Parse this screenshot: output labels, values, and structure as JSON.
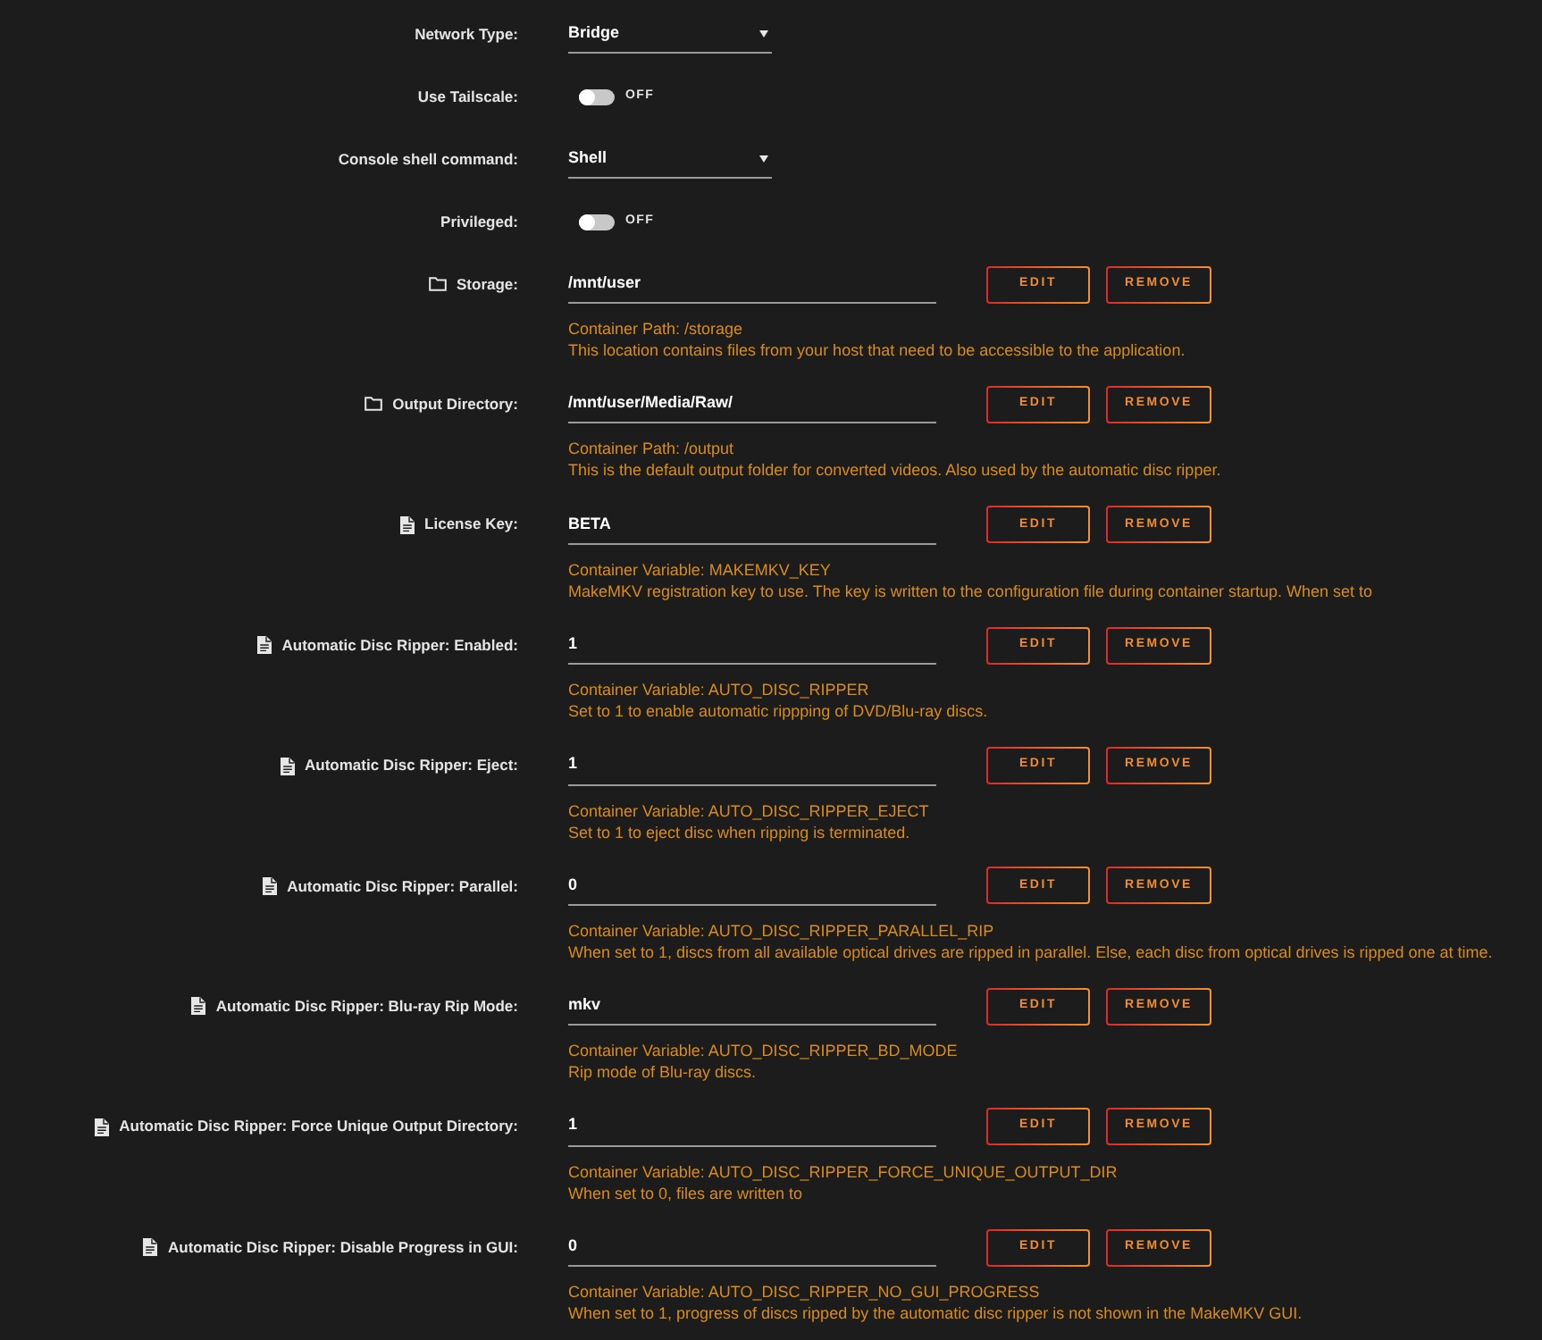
{
  "settings": [
    {
      "kind": "select",
      "label": "Network Type:",
      "value": "Bridge"
    },
    {
      "kind": "toggle",
      "label": "Use Tailscale:",
      "on": false,
      "state_text": "OFF"
    },
    {
      "kind": "select",
      "label": "Console shell command:",
      "value": "Shell"
    },
    {
      "kind": "toggle",
      "label": "Privileged:",
      "on": false,
      "state_text": "OFF"
    }
  ],
  "config": [
    {
      "kind": "path",
      "label": "Storage:",
      "value": "/mnt/user",
      "container": "Container Path: /storage",
      "description": "This location contains files from your host that need to be accessible to the application.",
      "actions": [
        "EDIT",
        "REMOVE"
      ]
    },
    {
      "kind": "path",
      "label": "Output Directory:",
      "value": "/mnt/user/Media/Raw/",
      "container": "Container Path: /output",
      "description": "This is the default output folder for converted videos. Also used by the automatic disc ripper.",
      "actions": [
        "EDIT",
        "REMOVE"
      ]
    },
    {
      "kind": "variable",
      "label": "License Key:",
      "value": "BETA",
      "container": "Container Variable: MAKEMKV_KEY",
      "description": "MakeMKV registration key to use. The key is written to the configuration file during container startup. When set to",
      "actions": [
        "EDIT",
        "REMOVE"
      ]
    },
    {
      "kind": "variable",
      "label": "Automatic Disc Ripper: Enabled:",
      "value": "1",
      "container": "Container Variable: AUTO_DISC_RIPPER",
      "description": "Set to 1 to enable automatic rippping of DVD/Blu-ray discs.",
      "actions": [
        "EDIT",
        "REMOVE"
      ]
    },
    {
      "kind": "variable",
      "label": "Automatic Disc Ripper: Eject:",
      "value": "1",
      "container": "Container Variable: AUTO_DISC_RIPPER_EJECT",
      "description": "Set to 1 to eject disc when ripping is terminated.",
      "actions": [
        "EDIT",
        "REMOVE"
      ]
    },
    {
      "kind": "variable",
      "label": "Automatic Disc Ripper: Parallel:",
      "value": "0",
      "container": "Container Variable: AUTO_DISC_RIPPER_PARALLEL_RIP",
      "description": "When set to 1, discs from all available optical drives are ripped in parallel. Else, each disc from optical drives is ripped one at time.",
      "actions": [
        "EDIT",
        "REMOVE"
      ]
    },
    {
      "kind": "variable",
      "label": "Automatic Disc Ripper: Blu-ray Rip Mode:",
      "value": "mkv",
      "container": "Container Variable: AUTO_DISC_RIPPER_BD_MODE",
      "description": "Rip mode of Blu-ray discs.",
      "actions": [
        "EDIT",
        "REMOVE"
      ]
    },
    {
      "kind": "variable",
      "label": "Automatic Disc Ripper: Force Unique Output Directory:",
      "value": "1",
      "container": "Container Variable: AUTO_DISC_RIPPER_FORCE_UNIQUE_OUTPUT_DIR",
      "description": "When set to 0, files are written to",
      "actions": [
        "EDIT",
        "REMOVE"
      ]
    },
    {
      "kind": "variable",
      "label": "Automatic Disc Ripper: Disable Progress in GUI:",
      "value": "0",
      "container": "Container Variable: AUTO_DISC_RIPPER_NO_GUI_PROGRESS",
      "description": "When set to 1, progress of discs ripped by the automatic disc ripper is not shown in the MakeMKV GUI.",
      "actions": [
        "EDIT",
        "REMOVE"
      ]
    }
  ]
}
